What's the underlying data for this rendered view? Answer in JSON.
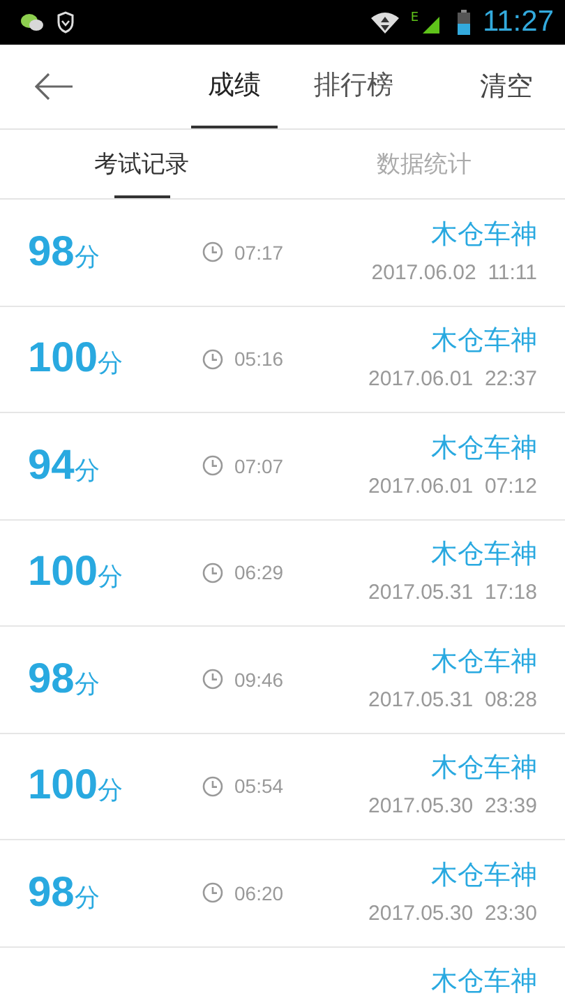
{
  "status_bar": {
    "network": "E",
    "time": "11:27"
  },
  "header": {
    "tabs": [
      {
        "label": "成绩",
        "selected": true
      },
      {
        "label": "排行榜",
        "selected": false
      }
    ],
    "action": "清空"
  },
  "sub_tabs": [
    {
      "label": "考试记录",
      "selected": true
    },
    {
      "label": "数据统计",
      "selected": false
    }
  ],
  "records": [
    {
      "score": "98",
      "unit": "分",
      "duration": "07:17",
      "name": "木仓车神",
      "date": "2017.06.02  11:11"
    },
    {
      "score": "100",
      "unit": "分",
      "duration": "05:16",
      "name": "木仓车神",
      "date": "2017.06.01  22:37"
    },
    {
      "score": "94",
      "unit": "分",
      "duration": "07:07",
      "name": "木仓车神",
      "date": "2017.06.01  07:12"
    },
    {
      "score": "100",
      "unit": "分",
      "duration": "06:29",
      "name": "木仓车神",
      "date": "2017.05.31  17:18"
    },
    {
      "score": "98",
      "unit": "分",
      "duration": "09:46",
      "name": "木仓车神",
      "date": "2017.05.31  08:28"
    },
    {
      "score": "100",
      "unit": "分",
      "duration": "05:54",
      "name": "木仓车神",
      "date": "2017.05.30  23:39"
    },
    {
      "score": "98",
      "unit": "分",
      "duration": "06:20",
      "name": "木仓车神",
      "date": "2017.05.30  23:30"
    },
    {
      "name": "木仓车神"
    }
  ]
}
